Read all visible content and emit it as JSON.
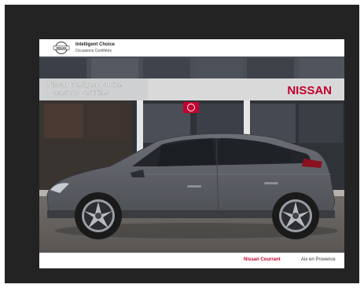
{
  "header": {
    "brand_name": "NISSAN",
    "program_title": "Intelligent Choice",
    "program_subtitle": "Occasions Certifiées"
  },
  "photo": {
    "facade_sign_line1": "Nissan Intelligent Choice",
    "facade_sign_line2": "Occasions Certifiées",
    "facade_logo_text": "NISSAN",
    "car_color": "#5b5e63",
    "accent_color": "#c3002f"
  },
  "footer": {
    "dealer_name": "Nissan Courrant",
    "location": "Aix en Provence"
  }
}
